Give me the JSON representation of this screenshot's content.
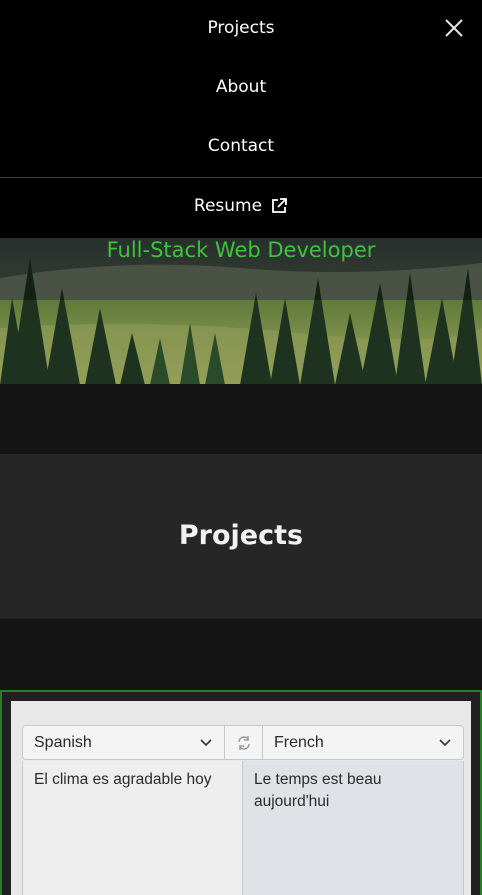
{
  "nav": {
    "items": [
      {
        "label": "Projects"
      },
      {
        "label": "About"
      },
      {
        "label": "Contact"
      }
    ],
    "resume_label": "Resume",
    "close_icon": "close-icon",
    "external_icon": "external-link-icon"
  },
  "hero": {
    "title": "Full-Stack Web Developer",
    "title_color": "#3ec43a"
  },
  "projects": {
    "heading": "Projects"
  },
  "translator": {
    "source_language": "Spanish",
    "target_language": "French",
    "swap_icon": "swap-icon",
    "source_text": "El clima es agradable hoy",
    "target_text": "Le temps est beau aujourd'hui"
  },
  "colors": {
    "accent_green": "#3ba63a",
    "nav_bg": "#000000",
    "page_bg": "#141414",
    "band_bg": "#262626"
  }
}
